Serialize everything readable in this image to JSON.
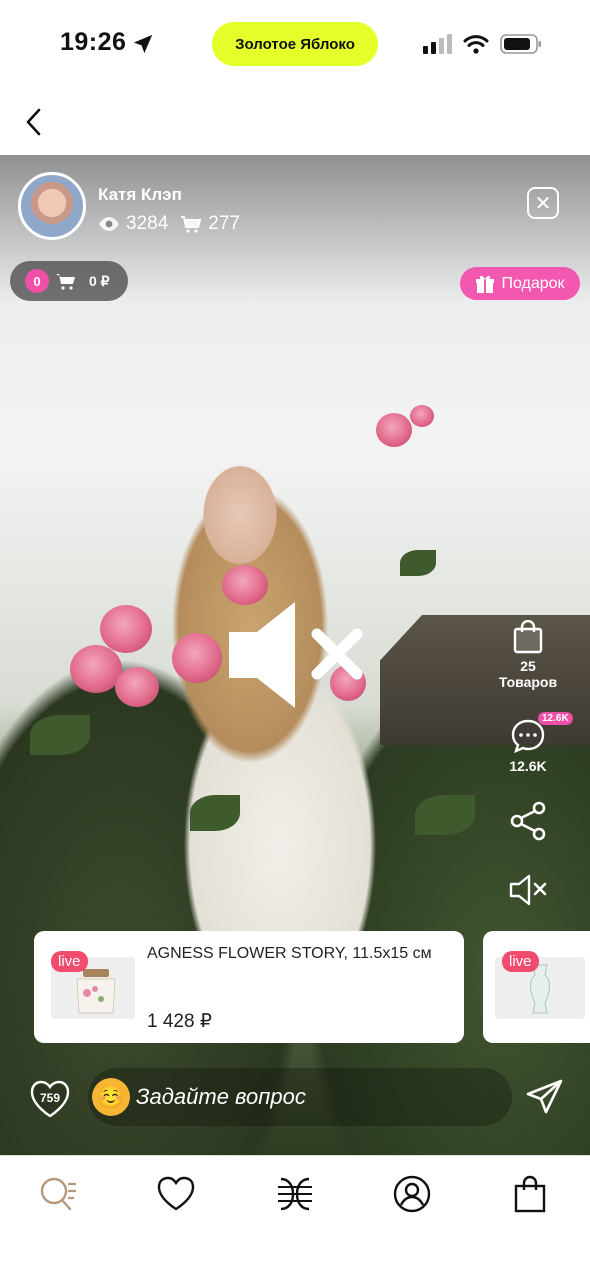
{
  "status_bar": {
    "time": "19:26",
    "carrier_pill": "Золотое Яблоко"
  },
  "stream": {
    "host_name": "Катя Клэп",
    "views": "3284",
    "cart_adds": "277",
    "cart_chip": {
      "count": "0",
      "total": "0 ₽"
    },
    "gift_label": "Подарок"
  },
  "side_actions": {
    "products_count": "25",
    "products_label": "Товаров",
    "comments_badge": "12.6K",
    "comments_count": "12.6K"
  },
  "products": [
    {
      "live": "live",
      "title": "AGNESS FLOWER STORY, 11.5x15 см",
      "price": "1 428 ₽"
    },
    {
      "live": "live",
      "title": "",
      "price": ""
    }
  ],
  "input_bar": {
    "likes": "759",
    "emoji": "☺️",
    "placeholder": "Задайте вопрос"
  },
  "colors": {
    "accent_pill": "#e4ff2a",
    "pink": "#f04fa8",
    "live_red": "#f14b6d"
  }
}
